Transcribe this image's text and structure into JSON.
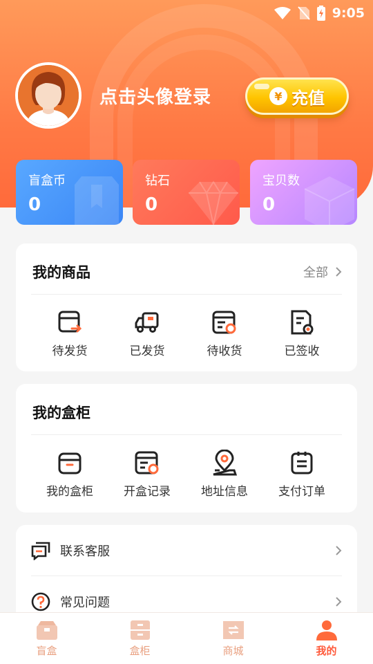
{
  "status_bar": {
    "time": "9:05",
    "icons": [
      "wifi-icon",
      "sim-off-icon",
      "battery-charging-icon"
    ]
  },
  "header": {
    "login_prompt": "点击头像登录",
    "recharge": {
      "symbol": "¥",
      "label": "充值"
    }
  },
  "stats": [
    {
      "title": "盲盒币",
      "value": "0"
    },
    {
      "title": "钻石",
      "value": "0"
    },
    {
      "title": "宝贝数",
      "value": "0"
    }
  ],
  "my_goods": {
    "title": "我的商品",
    "see_all": "全部",
    "items": [
      {
        "label": "待发货",
        "icon": "pending-ship-icon"
      },
      {
        "label": "已发货",
        "icon": "truck-icon"
      },
      {
        "label": "待收货",
        "icon": "pending-receive-icon"
      },
      {
        "label": "已签收",
        "icon": "signed-icon"
      }
    ]
  },
  "my_cabinet": {
    "title": "我的盒柜",
    "items": [
      {
        "label": "我的盒柜",
        "icon": "box-icon"
      },
      {
        "label": "开盒记录",
        "icon": "record-icon"
      },
      {
        "label": "地址信息",
        "icon": "location-icon"
      },
      {
        "label": "支付订单",
        "icon": "order-icon"
      }
    ]
  },
  "services": [
    {
      "label": "联系客服",
      "icon": "customer-service-icon"
    },
    {
      "label": "常见问题",
      "icon": "question-icon"
    }
  ],
  "tabbar": [
    {
      "label": "盲盒",
      "icon": "blind-box-icon",
      "active": false
    },
    {
      "label": "盒柜",
      "icon": "cabinet-icon",
      "active": false
    },
    {
      "label": "商城",
      "icon": "mall-icon",
      "active": false
    },
    {
      "label": "我的",
      "icon": "profile-icon",
      "active": true
    }
  ],
  "colors": {
    "accent": "#ff6a3b",
    "coin_card": "#3a86f6",
    "diamond_card": "#ff5a4b",
    "treasure_card": "#b687ff",
    "recharge": "#ffc400"
  }
}
